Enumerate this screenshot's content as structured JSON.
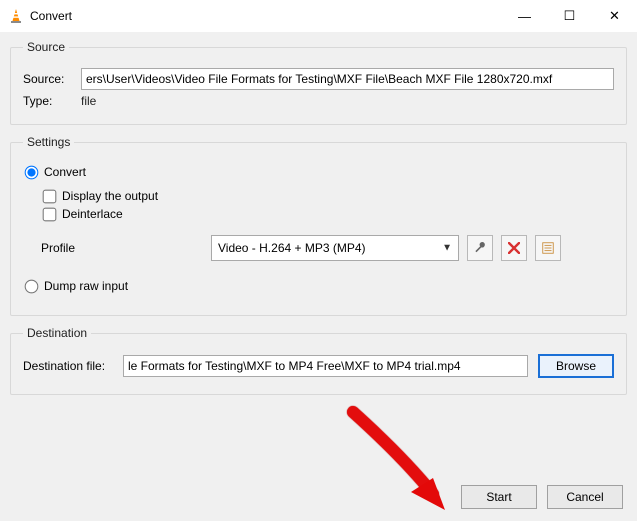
{
  "window": {
    "title": "Convert",
    "buttons": {
      "min": "—",
      "max": "☐",
      "close": "✕"
    }
  },
  "source": {
    "legend": "Source",
    "source_label": "Source:",
    "source_value": "ers\\User\\Videos\\Video File Formats for Testing\\MXF File\\Beach MXF File 1280x720.mxf",
    "type_label": "Type:",
    "type_value": "file"
  },
  "settings": {
    "legend": "Settings",
    "convert_label": "Convert",
    "display_output_label": "Display the output",
    "deinterlace_label": "Deinterlace",
    "profile_label": "Profile",
    "profile_value": "Video - H.264 + MP3 (MP4)",
    "dump_raw_label": "Dump raw input"
  },
  "destination": {
    "legend": "Destination",
    "label": "Destination file:",
    "value": "le Formats for Testing\\MXF to MP4 Free\\MXF to MP4 trial.mp4",
    "browse": "Browse"
  },
  "footer": {
    "start": "Start",
    "cancel": "Cancel"
  },
  "icons": {
    "tools": "wrench-icon",
    "delete": "x-icon",
    "new_profile": "list-icon"
  }
}
